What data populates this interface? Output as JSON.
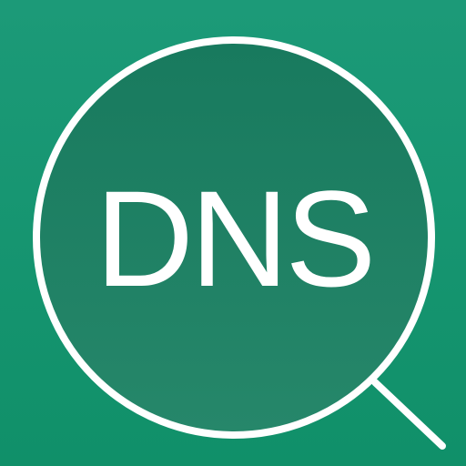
{
  "app_icon": {
    "label": "DNS",
    "icon": "magnifying-glass-icon",
    "colors": {
      "background_top": "#1c9a78",
      "background_bottom": "#109069",
      "lens_top": "#187a5e",
      "lens_bottom": "#26876a",
      "stroke": "#ffffff",
      "text": "#ffffff"
    }
  }
}
